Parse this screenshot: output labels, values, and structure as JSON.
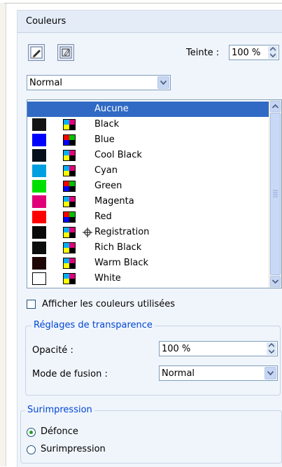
{
  "panel": {
    "title": "Couleurs"
  },
  "toolbar": {
    "tint_label": "Teinte :",
    "tint_value": "100 %",
    "fill_icon": "pencil-fill-icon",
    "stroke_icon": "brush-stroke-icon"
  },
  "mode_select": {
    "value": "Normal"
  },
  "swatches": [
    {
      "name": "Aucune",
      "color": "",
      "selected": true
    },
    {
      "name": "Black",
      "color": "#141414"
    },
    {
      "name": "Blue",
      "color": "#0000ff"
    },
    {
      "name": "Cool Black",
      "color": "#06101c"
    },
    {
      "name": "Cyan",
      "color": "#00a0e0"
    },
    {
      "name": "Green",
      "color": "#00e000"
    },
    {
      "name": "Magenta",
      "color": "#e0007a"
    },
    {
      "name": "Red",
      "color": "#ff0000"
    },
    {
      "name": "Registration",
      "color": "#0a0a0a",
      "registration": true
    },
    {
      "name": "Rich Black",
      "color": "#0c0c0c"
    },
    {
      "name": "Warm Black",
      "color": "#1e0606"
    },
    {
      "name": "White",
      "color": "#ffffff"
    }
  ],
  "show_used": {
    "label": "Afficher les couleurs utilisées",
    "checked": false
  },
  "transparency": {
    "legend": "Réglages de transparence",
    "opacity_label": "Opacité :",
    "opacity_value": "100 %",
    "blend_label": "Mode de fusion :",
    "blend_value": "Normal"
  },
  "overprint": {
    "legend": "Surimpression",
    "options": [
      {
        "label": "Défonce",
        "selected": true
      },
      {
        "label": "Surimpression",
        "selected": false
      }
    ]
  },
  "colors": {
    "selection": "#316ac5",
    "legend": "#0046d5",
    "panel_bg": "#f0f5fc"
  }
}
